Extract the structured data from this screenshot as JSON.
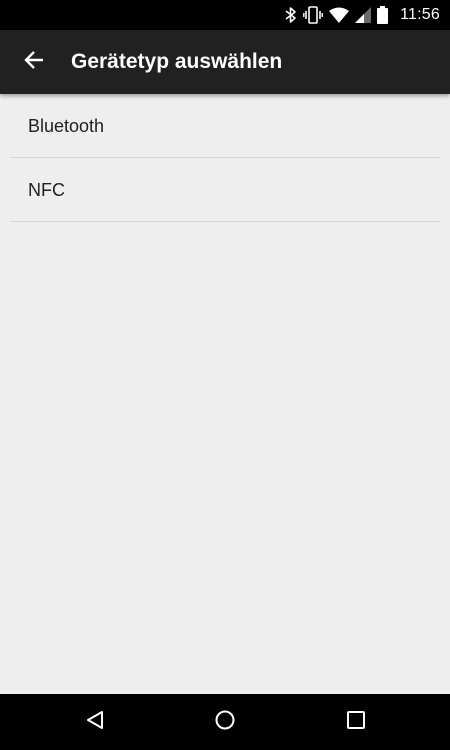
{
  "status_bar": {
    "time": "11:56",
    "icons": [
      "bluetooth-icon",
      "vibrate-icon",
      "wifi-icon",
      "cell-signal-icon",
      "battery-icon"
    ]
  },
  "app_bar": {
    "back_icon": "arrow-back-icon",
    "title": "Gerätetyp auswählen",
    "background": "#212121"
  },
  "list": {
    "items": [
      {
        "label": "Bluetooth"
      },
      {
        "label": "NFC"
      }
    ]
  },
  "nav_bar": {
    "icons": [
      "back-triangle-icon",
      "home-circle-icon",
      "recents-square-icon"
    ]
  },
  "colors": {
    "status_bar": "#000000",
    "app_bar": "#212121",
    "background": "#eeeeee",
    "divider": "#d6d6d6"
  }
}
